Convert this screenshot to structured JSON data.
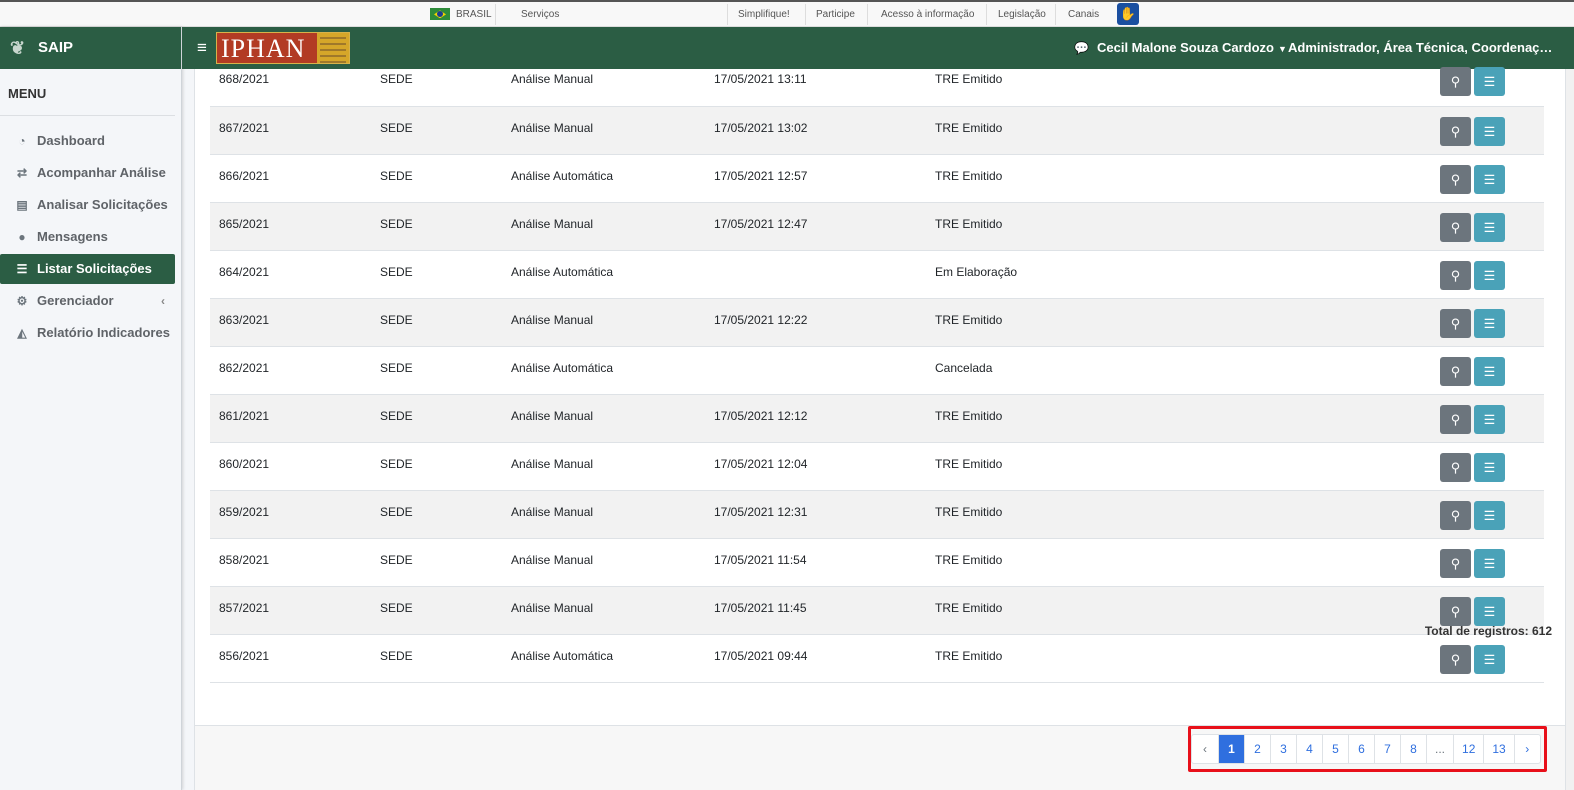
{
  "govbar": {
    "country": "BRASIL",
    "services": "Serviços",
    "links": [
      "Simplifique!",
      "Participe",
      "Acesso à informação",
      "Legislação",
      "Canais"
    ]
  },
  "sidebar": {
    "brand": "SAIP",
    "menu_title": "MENU",
    "items": [
      {
        "label": "Dashboard",
        "icon": "dashboard-icon"
      },
      {
        "label": "Acompanhar Análise",
        "icon": "exchange-icon"
      },
      {
        "label": "Analisar Solicitações",
        "icon": "book-icon"
      },
      {
        "label": "Mensagens",
        "icon": "comments-icon"
      },
      {
        "label": "Listar Solicitações",
        "icon": "list-icon",
        "active": true
      },
      {
        "label": "Gerenciador",
        "icon": "cogs-icon"
      },
      {
        "label": "Relatório Indicadores",
        "icon": "area-chart-icon"
      }
    ]
  },
  "header": {
    "logo_text": "IPHAN",
    "user": "Cecil Malone Souza Cardozo",
    "roles": "Administrador, Área Técnica, Coordenação Técnica"
  },
  "table": {
    "rows": [
      [
        "868/2021",
        "SEDE",
        "Análise Manual",
        "17/05/2021 13:11",
        "TRE Emitido"
      ],
      [
        "867/2021",
        "SEDE",
        "Análise Manual",
        "17/05/2021 13:02",
        "TRE Emitido"
      ],
      [
        "866/2021",
        "SEDE",
        "Análise Automática",
        "17/05/2021 12:57",
        "TRE Emitido"
      ],
      [
        "865/2021",
        "SEDE",
        "Análise Manual",
        "17/05/2021 12:47",
        "TRE Emitido"
      ],
      [
        "864/2021",
        "SEDE",
        "Análise Automática",
        "",
        "Em Elaboração"
      ],
      [
        "863/2021",
        "SEDE",
        "Análise Manual",
        "17/05/2021 12:22",
        "TRE Emitido"
      ],
      [
        "862/2021",
        "SEDE",
        "Análise Automática",
        "",
        "Cancelada"
      ],
      [
        "861/2021",
        "SEDE",
        "Análise Manual",
        "17/05/2021 12:12",
        "TRE Emitido"
      ],
      [
        "860/2021",
        "SEDE",
        "Análise Manual",
        "17/05/2021 12:04",
        "TRE Emitido"
      ],
      [
        "859/2021",
        "SEDE",
        "Análise Manual",
        "17/05/2021 12:31",
        "TRE Emitido"
      ],
      [
        "858/2021",
        "SEDE",
        "Análise Manual",
        "17/05/2021 11:54",
        "TRE Emitido"
      ],
      [
        "857/2021",
        "SEDE",
        "Análise Manual",
        "17/05/2021 11:45",
        "TRE Emitido"
      ],
      [
        "856/2021",
        "SEDE",
        "Análise Automática",
        "17/05/2021 09:44",
        "TRE Emitido"
      ]
    ],
    "total_label": "Total de registros: 612"
  },
  "pagination": {
    "prev": "‹",
    "pages": [
      "1",
      "2",
      "3",
      "4",
      "5",
      "6",
      "7",
      "8",
      "...",
      "12",
      "13"
    ],
    "active": "1",
    "next": "›"
  }
}
